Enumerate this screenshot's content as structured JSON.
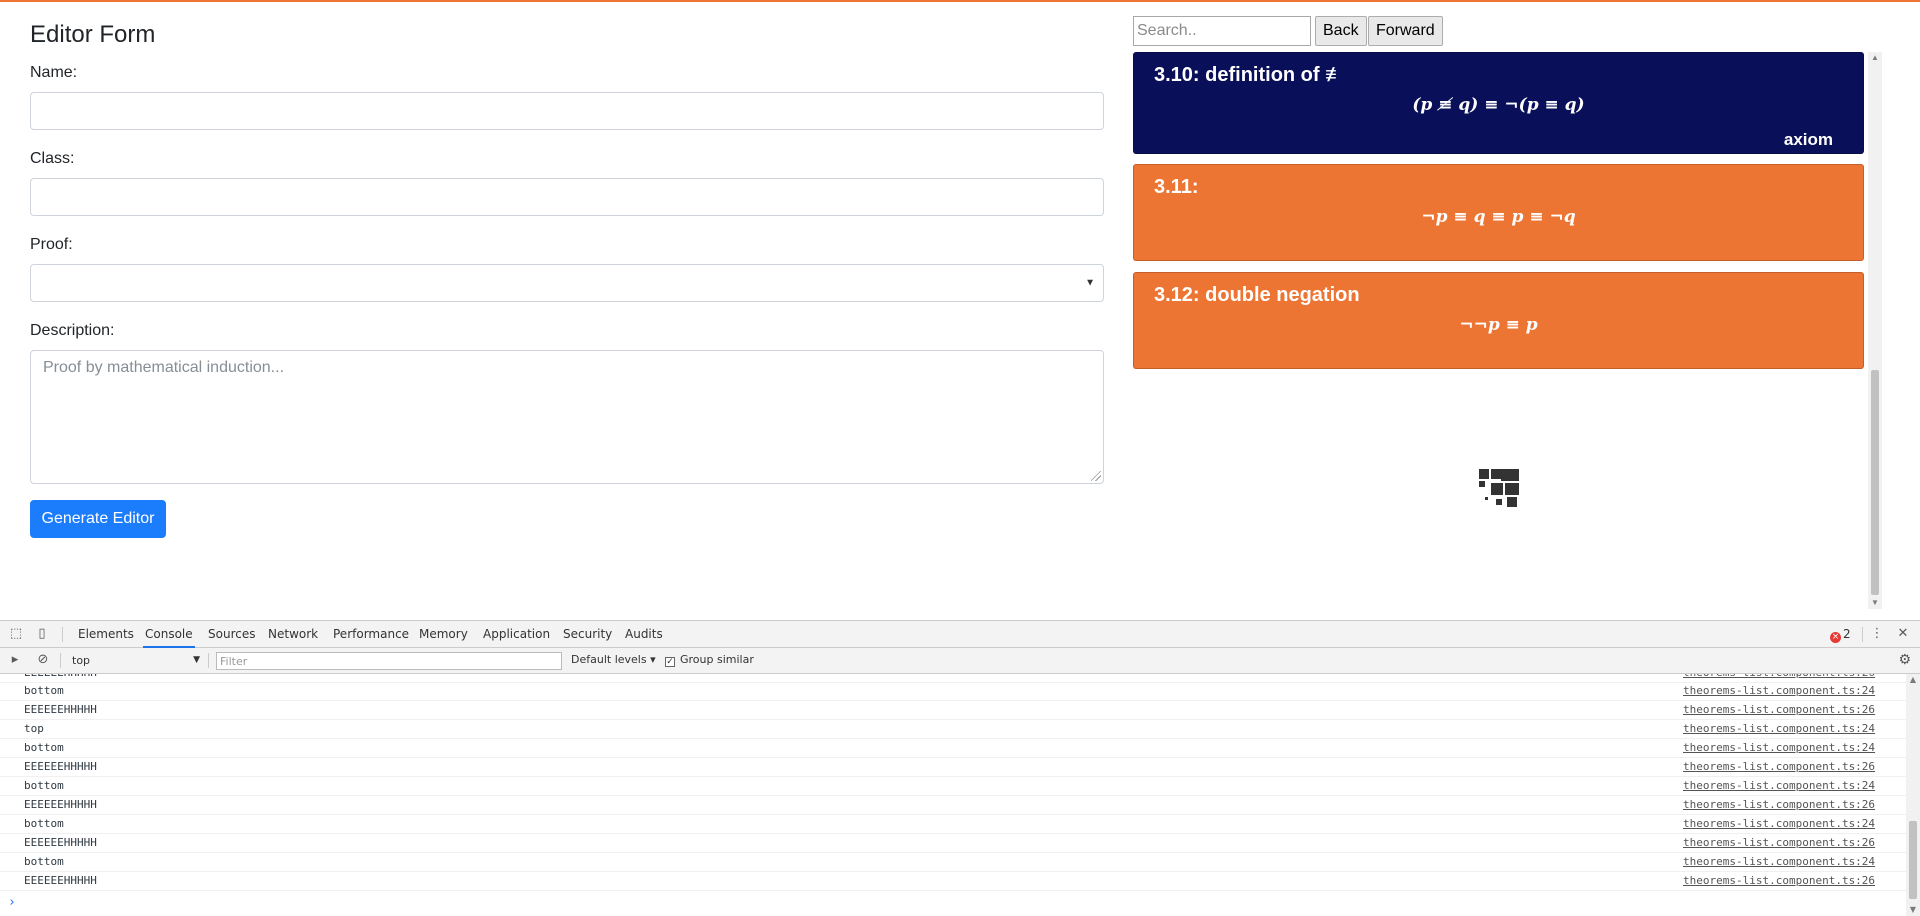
{
  "editor": {
    "title": "Editor Form",
    "name_label": "Name:",
    "name_value": "",
    "class_label": "Class:",
    "class_value": "",
    "proof_label": "Proof:",
    "proof_selected": "",
    "description_label": "Description:",
    "description_placeholder": "Proof by mathematical induction...",
    "generate_button": "Generate Editor"
  },
  "theorems": {
    "search_placeholder": "Search..",
    "back_label": "Back",
    "forward_label": "Forward",
    "cards": [
      {
        "title": "3.10: definition of ≢",
        "formula": "(p ≢ q)  ≡  ¬(p ≡ q)",
        "tag": "axiom",
        "color": "#0a0f5a"
      },
      {
        "title": "3.11:",
        "formula": "¬p ≡ q ≡ p ≡ ¬q",
        "tag": "",
        "color": "#ed7534"
      },
      {
        "title": "3.12: double negation",
        "formula": "¬¬p ≡ p",
        "tag": "",
        "color": "#ed7534"
      }
    ]
  },
  "devtools": {
    "tabs": [
      "Elements",
      "Console",
      "Sources",
      "Network",
      "Performance",
      "Memory",
      "Application",
      "Security",
      "Audits"
    ],
    "active_tab": "Console",
    "error_count": "2",
    "context": "top",
    "filter_placeholder": "Filter",
    "levels_label": "Default levels",
    "group_similar_label": "Group similar",
    "group_similar_checked": true,
    "logs": [
      {
        "msg": "EEEEEEHHHHH",
        "src": "theorems-list.component.ts:26"
      },
      {
        "msg": "bottom",
        "src": "theorems-list.component.ts:24"
      },
      {
        "msg": "EEEEEEHHHHH",
        "src": "theorems-list.component.ts:26"
      },
      {
        "msg": "top",
        "src": "theorems-list.component.ts:24"
      },
      {
        "msg": "bottom",
        "src": "theorems-list.component.ts:24"
      },
      {
        "msg": "EEEEEEHHHHH",
        "src": "theorems-list.component.ts:26"
      },
      {
        "msg": "bottom",
        "src": "theorems-list.component.ts:24"
      },
      {
        "msg": "EEEEEEHHHHH",
        "src": "theorems-list.component.ts:26"
      },
      {
        "msg": "bottom",
        "src": "theorems-list.component.ts:24"
      },
      {
        "msg": "EEEEEEHHHHH",
        "src": "theorems-list.component.ts:26"
      },
      {
        "msg": "bottom",
        "src": "theorems-list.component.ts:24"
      },
      {
        "msg": "EEEEEEHHHHH",
        "src": "theorems-list.component.ts:26"
      }
    ],
    "icons": [
      "inspect-icon",
      "device-toggle-icon",
      "close-icon",
      "more-icon",
      "sidebar-toggle-icon",
      "clear-console-icon",
      "settings-gear-icon"
    ]
  }
}
